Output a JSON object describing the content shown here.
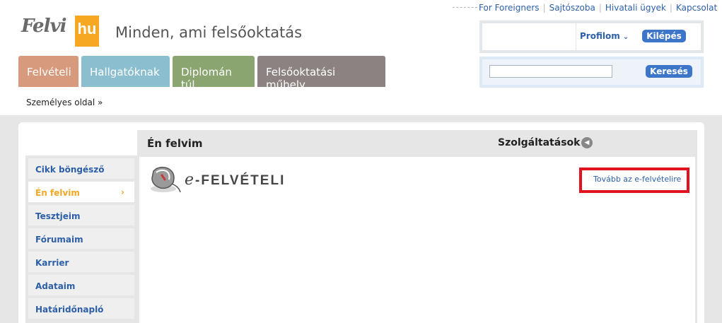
{
  "top_links": [
    "For Foreigners",
    "Sajtószoba",
    "Hivatali ügyek",
    "Kapcsolat"
  ],
  "logo": {
    "word": "Felvi",
    "suffix": "hu",
    "accent_color": "#f7a823"
  },
  "tagline": "Minden, ami felsőoktatás",
  "tabs": [
    {
      "label": "Felvételi",
      "color": "#d89a7d"
    },
    {
      "label": "Hallgatóknak",
      "color": "#8bbfd0"
    },
    {
      "label": "Diplomán túl",
      "color": "#8aa56f"
    },
    {
      "label": "Felsőoktatási műhely",
      "color": "#8c8282"
    }
  ],
  "breadcrumb": "Személyes oldal »",
  "account": {
    "profile_label": "Profilom",
    "logout_label": "Kilépés"
  },
  "search": {
    "button_label": "Keresés",
    "value": ""
  },
  "sidebar": {
    "items": [
      {
        "label": "Cikk böngésző",
        "active": false
      },
      {
        "label": "Én felvim",
        "active": true
      },
      {
        "label": "Tesztjeim",
        "active": false
      },
      {
        "label": "Fórumaim",
        "active": false
      },
      {
        "label": "Karrier",
        "active": false
      },
      {
        "label": "Adataim",
        "active": false
      },
      {
        "label": "Határidőnapló",
        "active": false
      }
    ],
    "active_arrow": "›"
  },
  "panel": {
    "title": "Én felvim",
    "services_label": "Szolgáltatások",
    "services_icon": "arrow-left-circle-icon"
  },
  "efelveteli": {
    "logo_prefix": "e",
    "logo_text": "-FELVÉTELI",
    "link_label": "Tovább az e-felvételire",
    "highlight_color": "#e2131e"
  }
}
